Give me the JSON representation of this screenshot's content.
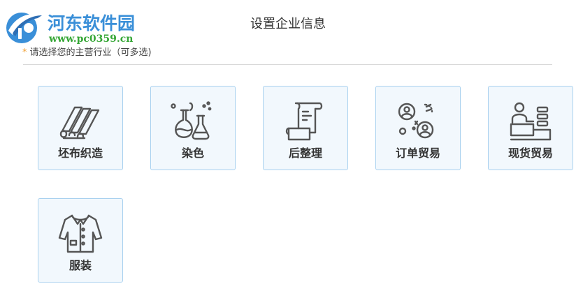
{
  "watermark": {
    "name": "河东软件园",
    "url": "www.pc0359.cn"
  },
  "page": {
    "title": "设置企业信息",
    "instruction_star": "*",
    "instruction": "请选择您的主营行业（可多选)"
  },
  "industries": [
    {
      "label": "坯布织造",
      "icon": "fabric-rolls-icon"
    },
    {
      "label": "染色",
      "icon": "flask-icon"
    },
    {
      "label": "后整理",
      "icon": "document-scroll-icon"
    },
    {
      "label": "订单贸易",
      "icon": "trade-people-icon"
    },
    {
      "label": "现货贸易",
      "icon": "counter-stock-icon"
    },
    {
      "label": "服装",
      "icon": "clothing-icon"
    }
  ],
  "colors": {
    "card_bg": "#f2f8fd",
    "card_border": "#a9d1ef",
    "icon_stroke": "#555555",
    "accent_star": "#f0a23a",
    "watermark_blue": "#3a8fd8",
    "watermark_green": "#35a635"
  }
}
